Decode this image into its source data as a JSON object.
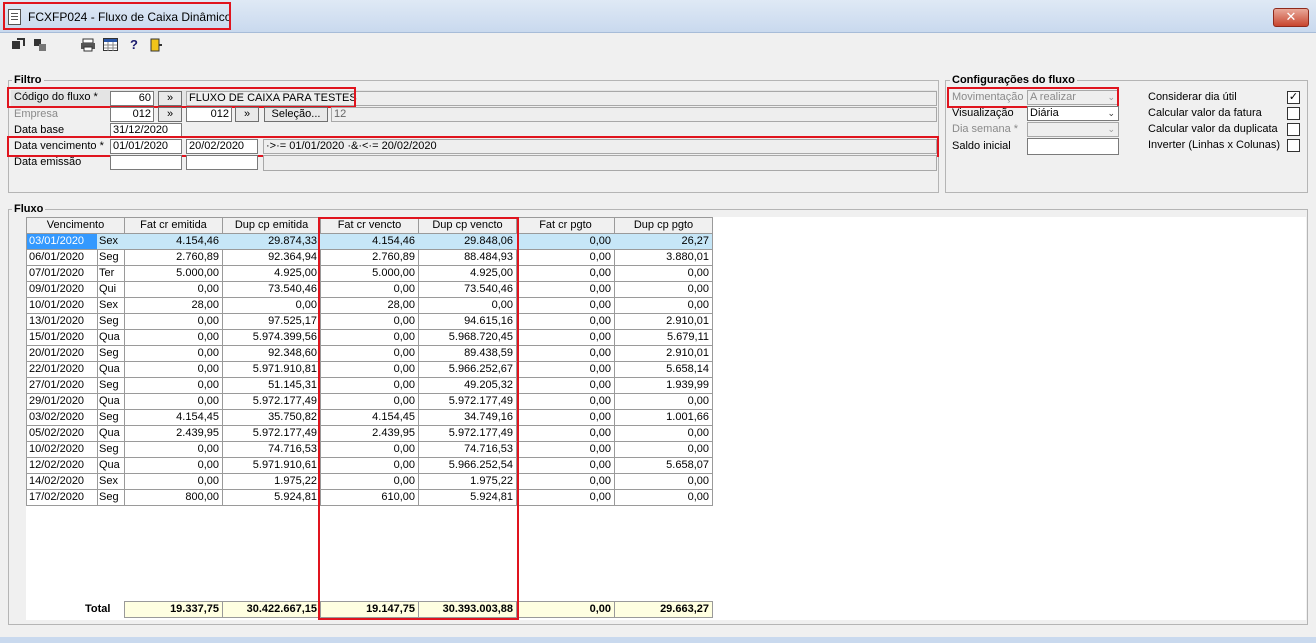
{
  "window": {
    "title": "FCXFP024 - Fluxo de Caixa Dinâmico",
    "close_label": "✕"
  },
  "toolbar": {
    "icons": [
      "import-icon",
      "export-icon",
      "print-icon",
      "grid-icon",
      "help-icon",
      "exit-icon"
    ]
  },
  "filtro": {
    "title": "Filtro",
    "codigo_label": "Código do fluxo *",
    "codigo_value": "60",
    "codigo_button": "»",
    "codigo_desc": "FLUXO DE CAIXA PARA TESTES",
    "empresa_label": "Empresa",
    "empresa_from": "012",
    "empresa_button": "»",
    "empresa_to": "012",
    "empresa_button2": "»",
    "selecao_label": "Seleção...",
    "empresa_desc": "12",
    "data_base_label": "Data base",
    "data_base_value": "31/12/2020",
    "venc_label": "Data vencimento *",
    "venc_from": "01/01/2020",
    "venc_to": "20/02/2020",
    "venc_expr": "·>·= 01/01/2020 ·&·<·= 20/02/2020",
    "emissao_label": "Data emissão",
    "emissao_from": "",
    "emissao_to": ""
  },
  "config": {
    "title": "Configurações do fluxo",
    "movimentacao_label": "Movimentação",
    "movimentacao_value": "A realizar",
    "visualizacao_label": "Visualização",
    "visualizacao_value": "Diária",
    "dia_semana_label": "Dia semana *",
    "dia_semana_value": "",
    "saldo_label": "Saldo inicial",
    "saldo_value": "",
    "checks": [
      {
        "label": "Considerar dia útil",
        "checked": "✓"
      },
      {
        "label": "Calcular valor da fatura",
        "checked": ""
      },
      {
        "label": "Calcular valor da duplicata",
        "checked": ""
      },
      {
        "label": "Inverter (Linhas x Colunas)",
        "checked": ""
      }
    ]
  },
  "fluxo": {
    "title": "Fluxo",
    "headers": [
      "Vencimento",
      "Fat cr emitida",
      "Dup cp emitida",
      "Fat cr vencto",
      "Dup cp vencto",
      "Fat cr pgto",
      "Dup cp pgto"
    ],
    "rows": [
      [
        "03/01/2020",
        "Sex",
        "4.154,46",
        "29.874,33",
        "4.154,46",
        "29.848,06",
        "0,00",
        "26,27"
      ],
      [
        "06/01/2020",
        "Seg",
        "2.760,89",
        "92.364,94",
        "2.760,89",
        "88.484,93",
        "0,00",
        "3.880,01"
      ],
      [
        "07/01/2020",
        "Ter",
        "5.000,00",
        "4.925,00",
        "5.000,00",
        "4.925,00",
        "0,00",
        "0,00"
      ],
      [
        "09/01/2020",
        "Qui",
        "0,00",
        "73.540,46",
        "0,00",
        "73.540,46",
        "0,00",
        "0,00"
      ],
      [
        "10/01/2020",
        "Sex",
        "28,00",
        "0,00",
        "28,00",
        "0,00",
        "0,00",
        "0,00"
      ],
      [
        "13/01/2020",
        "Seg",
        "0,00",
        "97.525,17",
        "0,00",
        "94.615,16",
        "0,00",
        "2.910,01"
      ],
      [
        "15/01/2020",
        "Qua",
        "0,00",
        "5.974.399,56",
        "0,00",
        "5.968.720,45",
        "0,00",
        "5.679,11"
      ],
      [
        "20/01/2020",
        "Seg",
        "0,00",
        "92.348,60",
        "0,00",
        "89.438,59",
        "0,00",
        "2.910,01"
      ],
      [
        "22/01/2020",
        "Qua",
        "0,00",
        "5.971.910,81",
        "0,00",
        "5.966.252,67",
        "0,00",
        "5.658,14"
      ],
      [
        "27/01/2020",
        "Seg",
        "0,00",
        "51.145,31",
        "0,00",
        "49.205,32",
        "0,00",
        "1.939,99"
      ],
      [
        "29/01/2020",
        "Qua",
        "0,00",
        "5.972.177,49",
        "0,00",
        "5.972.177,49",
        "0,00",
        "0,00"
      ],
      [
        "03/02/2020",
        "Seg",
        "4.154,45",
        "35.750,82",
        "4.154,45",
        "34.749,16",
        "0,00",
        "1.001,66"
      ],
      [
        "05/02/2020",
        "Qua",
        "2.439,95",
        "5.972.177,49",
        "2.439,95",
        "5.972.177,49",
        "0,00",
        "0,00"
      ],
      [
        "10/02/2020",
        "Seg",
        "0,00",
        "74.716,53",
        "0,00",
        "74.716,53",
        "0,00",
        "0,00"
      ],
      [
        "12/02/2020",
        "Qua",
        "0,00",
        "5.971.910,61",
        "0,00",
        "5.966.252,54",
        "0,00",
        "5.658,07"
      ],
      [
        "14/02/2020",
        "Sex",
        "0,00",
        "1.975,22",
        "0,00",
        "1.975,22",
        "0,00",
        "0,00"
      ],
      [
        "17/02/2020",
        "Seg",
        "800,00",
        "5.924,81",
        "610,00",
        "5.924,81",
        "0,00",
        "0,00"
      ]
    ],
    "total_label": "Total",
    "totals": [
      "19.337,75",
      "30.422.667,15",
      "19.147,75",
      "30.393.003,88",
      "0,00",
      "29.663,27"
    ]
  }
}
